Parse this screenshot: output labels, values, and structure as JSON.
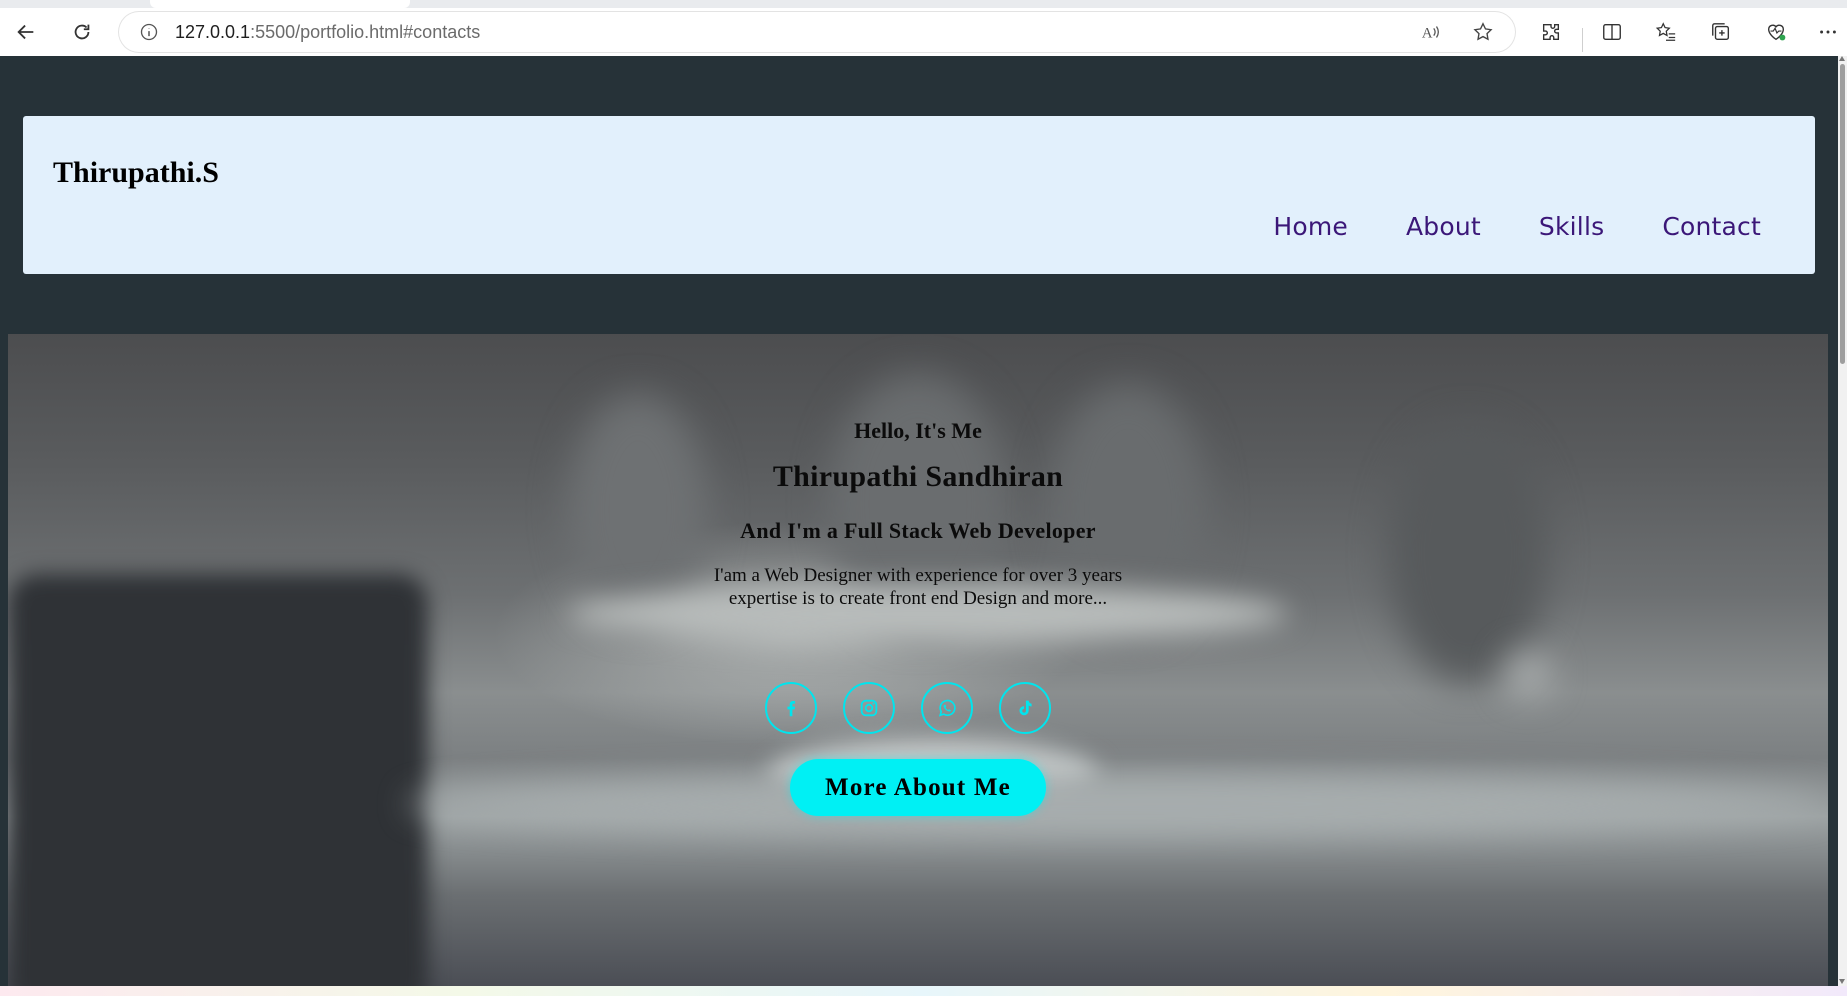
{
  "browser": {
    "url_host": "127.0.0.1",
    "url_rest": ":5500/portfolio.html#contacts",
    "read_aloud_label": "A͇"
  },
  "site": {
    "logo": "Thirupathi.S",
    "nav": [
      {
        "label": "Home"
      },
      {
        "label": "About"
      },
      {
        "label": "Skills"
      },
      {
        "label": "Contact"
      }
    ]
  },
  "hero": {
    "greeting": "Hello, It's Me",
    "name": "Thirupathi Sandhiran",
    "role": "And I'm a Full Stack Web Developer",
    "description_line1": "I'am a Web Designer with experience for over 3 years",
    "description_line2": "expertise is to create front end Design and more...",
    "socials": [
      {
        "icon": "facebook-icon"
      },
      {
        "icon": "instagram-icon"
      },
      {
        "icon": "whatsapp-icon"
      },
      {
        "icon": "tiktok-icon"
      }
    ],
    "cta_label": "More About Me"
  },
  "colors": {
    "page_bg": "#263238",
    "header_bg": "#e2f0fc",
    "nav_text": "#3b1778",
    "accent_cyan": "#00f0f4"
  }
}
